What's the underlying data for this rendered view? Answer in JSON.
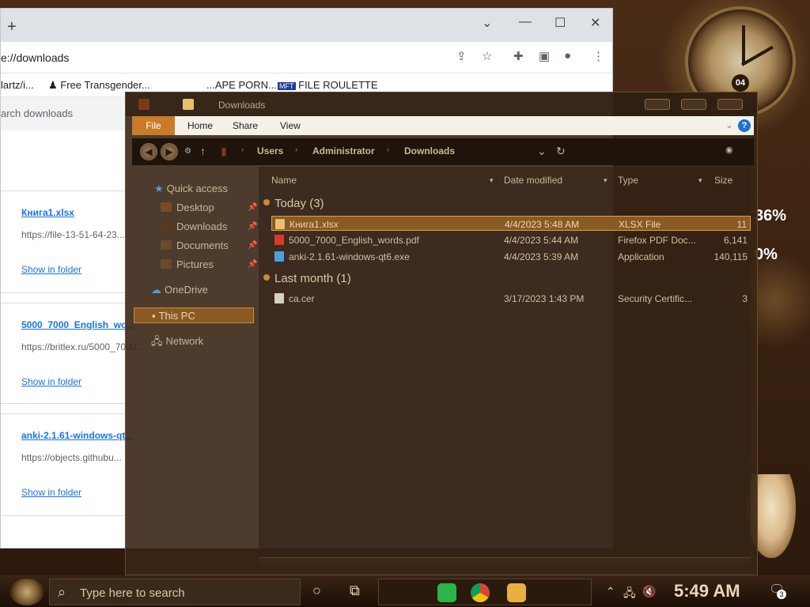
{
  "chrome": {
    "new_tab_glyph": "+",
    "url_text": "e://downloads",
    "bookmarks": [
      {
        "label": "lartz/i..."
      },
      {
        "label": "Free Transgender..."
      },
      {
        "label": "...APE PORN..."
      },
      {
        "label": "FILE ROULETTE"
      }
    ],
    "search_placeholder": "arch downloads",
    "downloads": [
      {
        "name": "Книга1.xlsx",
        "url": "https://file-13-51-64-23...",
        "action": "Show in folder"
      },
      {
        "name": "5000_7000_English_wo...",
        "url": "https://britlex.ru/5000_7000...",
        "action": "Show in folder"
      },
      {
        "name": "anki-2.1.61-windows-qt...",
        "url": "https://objects.githubu...",
        "action": "Show in folder"
      }
    ]
  },
  "explorer": {
    "title": "Downloads",
    "ribbon": {
      "file": "File",
      "home": "Home",
      "share": "Share",
      "view": "View",
      "help": "?"
    },
    "breadcrumb": [
      "Users",
      "Administrator",
      "Downloads"
    ],
    "sidebar": {
      "quick_access": "Quick access",
      "desktop": "Desktop",
      "downloads": "Downloads",
      "documents": "Documents",
      "pictures": "Pictures",
      "onedrive": "OneDrive",
      "this_pc": "This PC",
      "network": "Network"
    },
    "columns": {
      "name": "Name",
      "date": "Date modified",
      "type": "Type",
      "size": "Size"
    },
    "groups": [
      {
        "label": "Today (3)",
        "files": [
          {
            "name": "Книга1.xlsx",
            "date": "4/4/2023 5:48 AM",
            "type": "XLSX File",
            "size": "11",
            "icon_color": "#e8c070",
            "selected": true
          },
          {
            "name": "5000_7000_English_words.pdf",
            "date": "4/4/2023 5:44 AM",
            "type": "Firefox PDF Doc...",
            "size": "6,141",
            "icon_color": "#d83a2a",
            "selected": false
          },
          {
            "name": "anki-2.1.61-windows-qt6.exe",
            "date": "4/4/2023 5:39 AM",
            "type": "Application",
            "size": "140,115",
            "icon_color": "#4aa0e0",
            "selected": false
          }
        ]
      },
      {
        "label": "Last month (1)",
        "files": [
          {
            "name": "ca.cer",
            "date": "3/17/2023 1:43 PM",
            "type": "Security Certific...",
            "size": "3",
            "icon_color": "#d8d0c0",
            "selected": false
          }
        ]
      }
    ]
  },
  "taskbar": {
    "search_placeholder": "Type here to search",
    "time": "5:49 AM",
    "notification_count": "3"
  },
  "desktop": {
    "clock_number": "04",
    "percent_a": "36%",
    "percent_b": "0%"
  },
  "colors": {
    "accent_orange": "#c97b2a",
    "explorer_bg": "#3a2616",
    "link_blue": "#1a73e8"
  }
}
